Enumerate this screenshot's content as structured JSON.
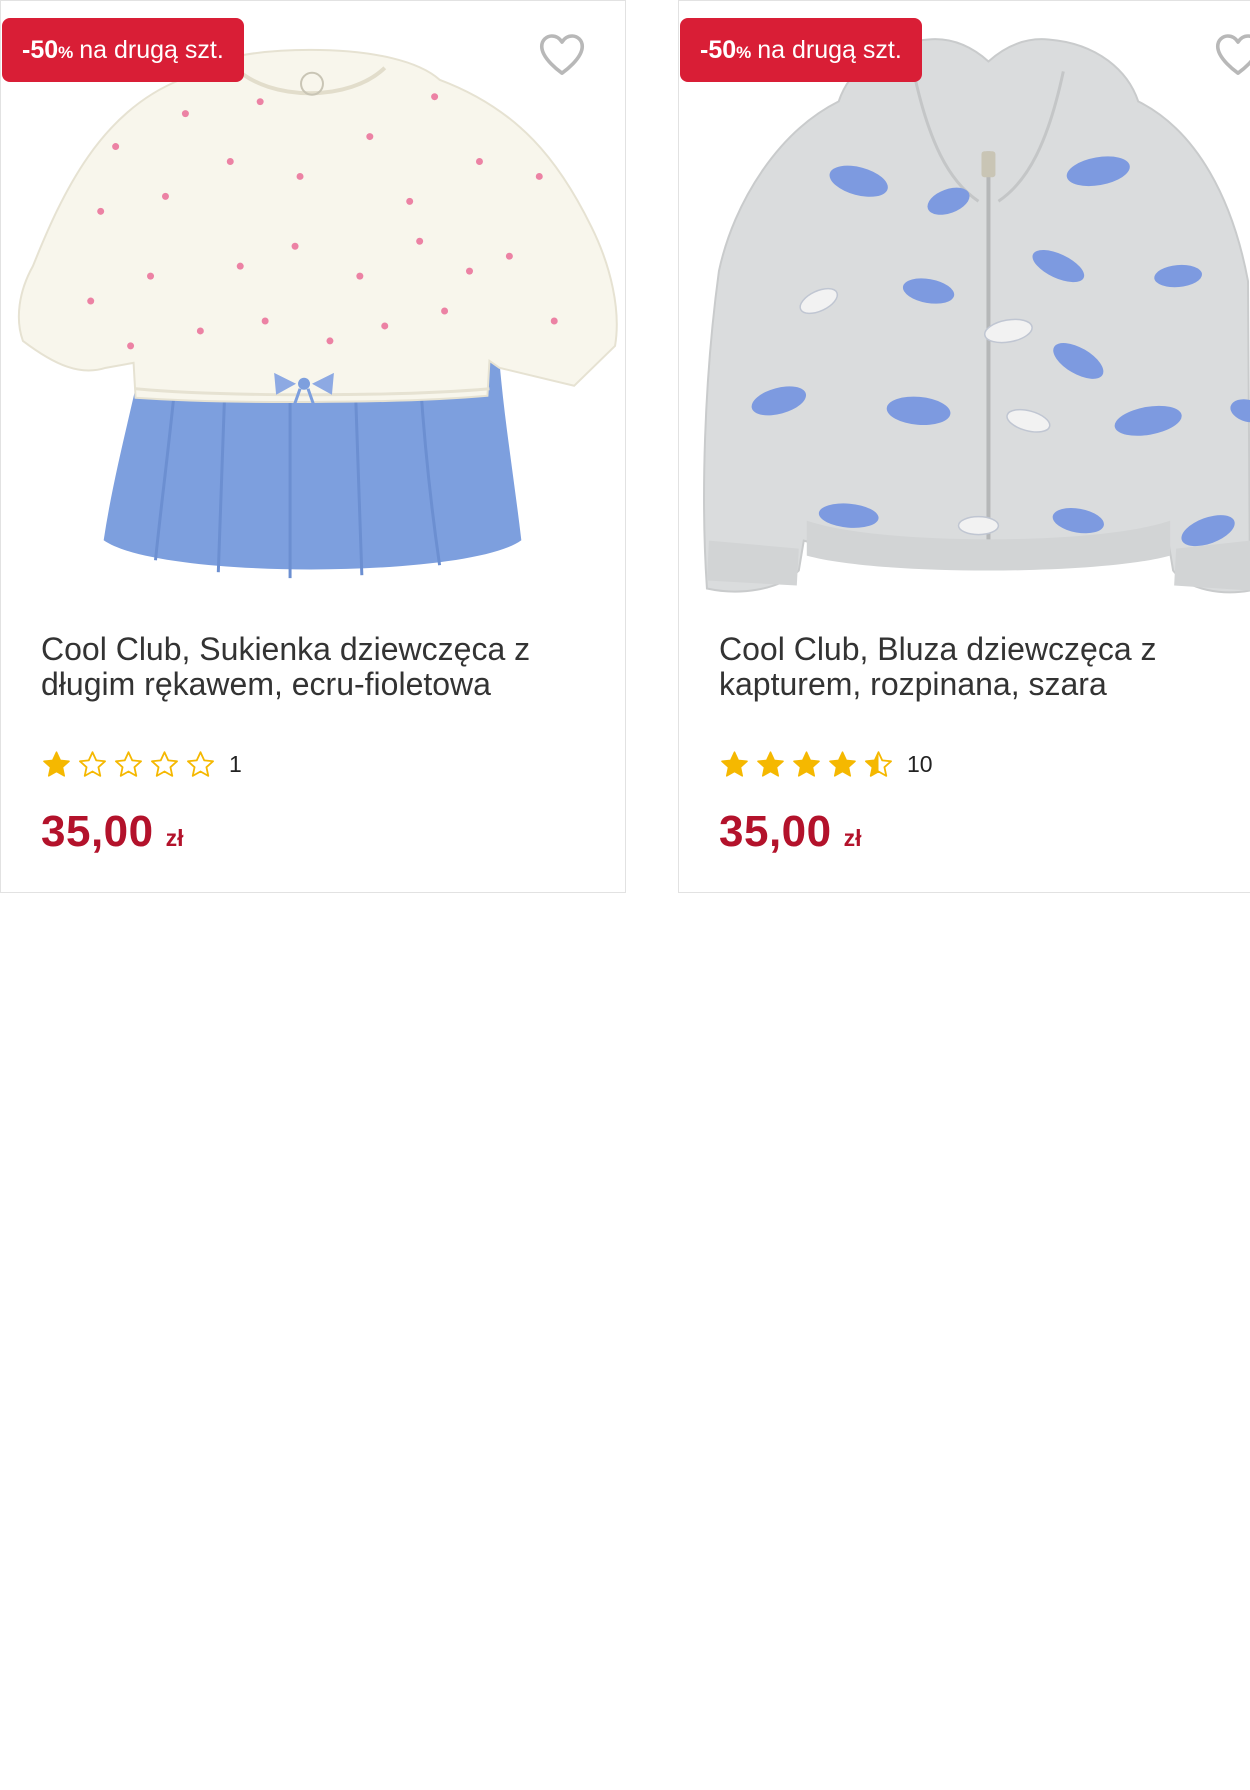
{
  "colors": {
    "badge_bg": "#d91e36",
    "price": "#b3122b",
    "star": "#f5b800",
    "title": "#333333"
  },
  "products": [
    {
      "badge": {
        "percent": "-50",
        "percent_sign": "%",
        "text": "na drugą szt."
      },
      "favorite_icon": "heart-outline-icon",
      "image_subject": "dress",
      "title": "Cool Club, Sukienka dziewczęca z długim rękawem, ecru-fioletowa",
      "rating": {
        "value": 1,
        "max": 5,
        "count": "1"
      },
      "price": {
        "amount": "35,00",
        "currency": "zł"
      }
    },
    {
      "badge": {
        "percent": "-50",
        "percent_sign": "%",
        "text": "na drugą szt."
      },
      "favorite_icon": "heart-outline-icon",
      "image_subject": "hoodie",
      "title": "Cool Club, Bluza dziewczęca z kapturem, rozpinana, szara",
      "rating": {
        "value": 4.5,
        "max": 5,
        "count": "10"
      },
      "price": {
        "amount": "35,00",
        "currency": "zł"
      }
    }
  ]
}
